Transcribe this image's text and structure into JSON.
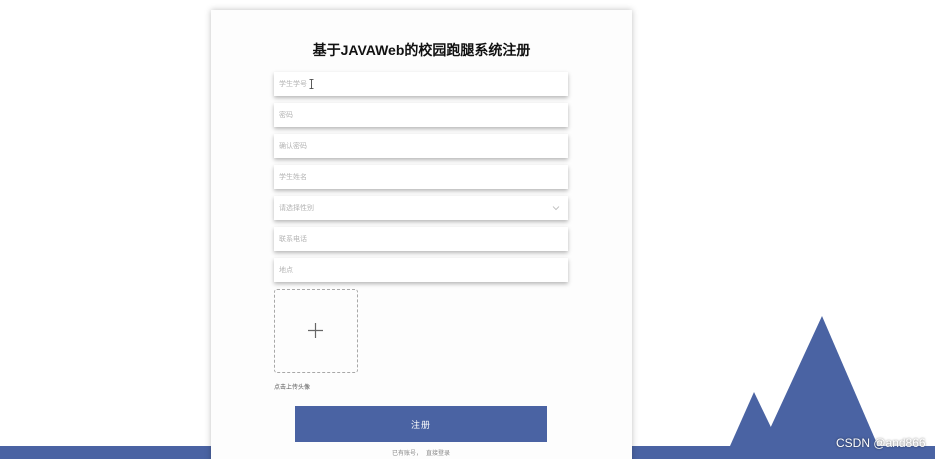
{
  "form": {
    "title": "基于JAVAWeb的校园跑腿系统注册",
    "fields": [
      {
        "placeholder": "学生学号"
      },
      {
        "placeholder": "密码"
      },
      {
        "placeholder": "确认密码"
      },
      {
        "placeholder": "学生姓名"
      },
      {
        "placeholder": "请选择性别"
      },
      {
        "placeholder": "联系电话"
      },
      {
        "placeholder": "地点"
      }
    ],
    "upload_hint": "点击上传头像",
    "submit_label": "注册",
    "login_link_prefix": "已有账号，",
    "login_link": "直接登录"
  },
  "watermark": "CSDN @and866",
  "colors": {
    "brand": "#4a63a3",
    "placeholder": "#b4b4b4"
  },
  "icons": {
    "upload": "plus-icon",
    "select": "chevron-down-icon",
    "cursor": "text-cursor-icon"
  }
}
